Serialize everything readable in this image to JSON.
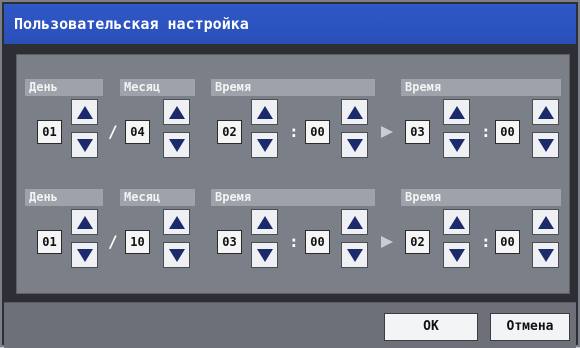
{
  "window": {
    "title": "Пользовательская настройка"
  },
  "rows": [
    {
      "day_label": "День",
      "day_value": "01",
      "month_label": "Месяц",
      "month_value": "04",
      "time1_label": "Время",
      "time1_hour": "02",
      "time1_min": "00",
      "time2_label": "Время",
      "time2_hour": "03",
      "time2_min": "00"
    },
    {
      "day_label": "День",
      "day_value": "01",
      "month_label": "Месяц",
      "month_value": "10",
      "time1_label": "Время",
      "time1_hour": "03",
      "time1_min": "00",
      "time2_label": "Время",
      "time2_hour": "02",
      "time2_min": "00"
    }
  ],
  "separators": {
    "date": "/",
    "time": ":"
  },
  "footer": {
    "ok_label": "OK",
    "cancel_label": "Отмена"
  },
  "icons": {
    "up": "up-arrow-icon",
    "down": "down-arrow-icon",
    "range": "right-arrow-icon"
  },
  "colors": {
    "title_bar": "#2f58c8",
    "panel": "#7b7f87",
    "header": "#9ea2aa"
  }
}
